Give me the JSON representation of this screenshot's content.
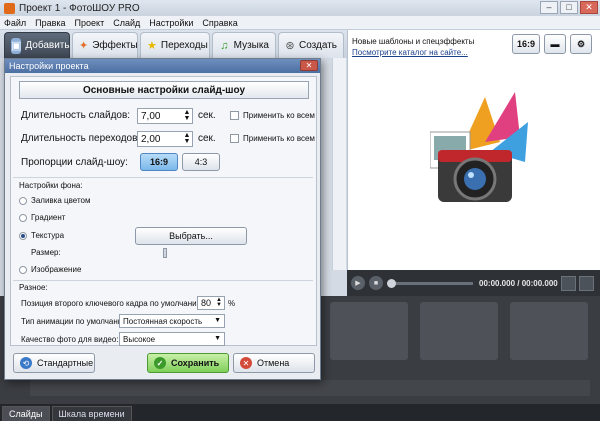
{
  "window": {
    "title": "Проект 1 - ФотоШОУ PRO",
    "min": "–",
    "max": "□",
    "close": "✕"
  },
  "menu": [
    "Файл",
    "Правка",
    "Проект",
    "Слайд",
    "Настройки",
    "Справка"
  ],
  "tabs": [
    {
      "label": "Добавить"
    },
    {
      "label": "Эффекты"
    },
    {
      "label": "Переходы"
    },
    {
      "label": "Музыка"
    },
    {
      "label": "Создать"
    }
  ],
  "news": {
    "line1": "Новые шаблоны и спецэффекты",
    "line2": "Посмотрите каталог на сайте..."
  },
  "ratio_button": "16:9",
  "player": {
    "time": "00:00.000 / 00:00.000"
  },
  "bottom_tabs": [
    "Слайды",
    "Шкала времени"
  ],
  "dialog": {
    "title": "Настройки проекта",
    "header": "Основные настройки слайд-шоу",
    "slide_duration_label": "Длительность слайдов:",
    "slide_duration_value": "7,00",
    "transition_duration_label": "Длительность переходов:",
    "transition_duration_value": "2,00",
    "sec": "сек.",
    "apply_all": "Применить ко всем",
    "aspect_label": "Пропорции слайд-шоу:",
    "aspect_169": "16:9",
    "aspect_43": "4:3",
    "bg_section": "Настройки фона:",
    "bg_fill": "Заливка цветом",
    "bg_gradient": "Градиент",
    "bg_texture": "Текстура",
    "choose_button": "Выбрать...",
    "size_label": "Размер:",
    "bg_image": "Изображение",
    "misc_section": "Разное:",
    "keyframe_label": "Позиция второго ключевого кадра по умолчанию:",
    "keyframe_value": "80",
    "percent": "%",
    "anim_label": "Тип анимации по умолчанию:",
    "anim_value": "Постоянная скорость",
    "quality_label": "Качество фото для видео:",
    "quality_value": "Высокое",
    "btn_default": "Стандартные",
    "btn_save": "Сохранить",
    "btn_cancel": "Отмена"
  },
  "colors": {
    "accent": "#4c6fa2",
    "save": "#7fcf5a",
    "cancel": "#d44a3a"
  }
}
